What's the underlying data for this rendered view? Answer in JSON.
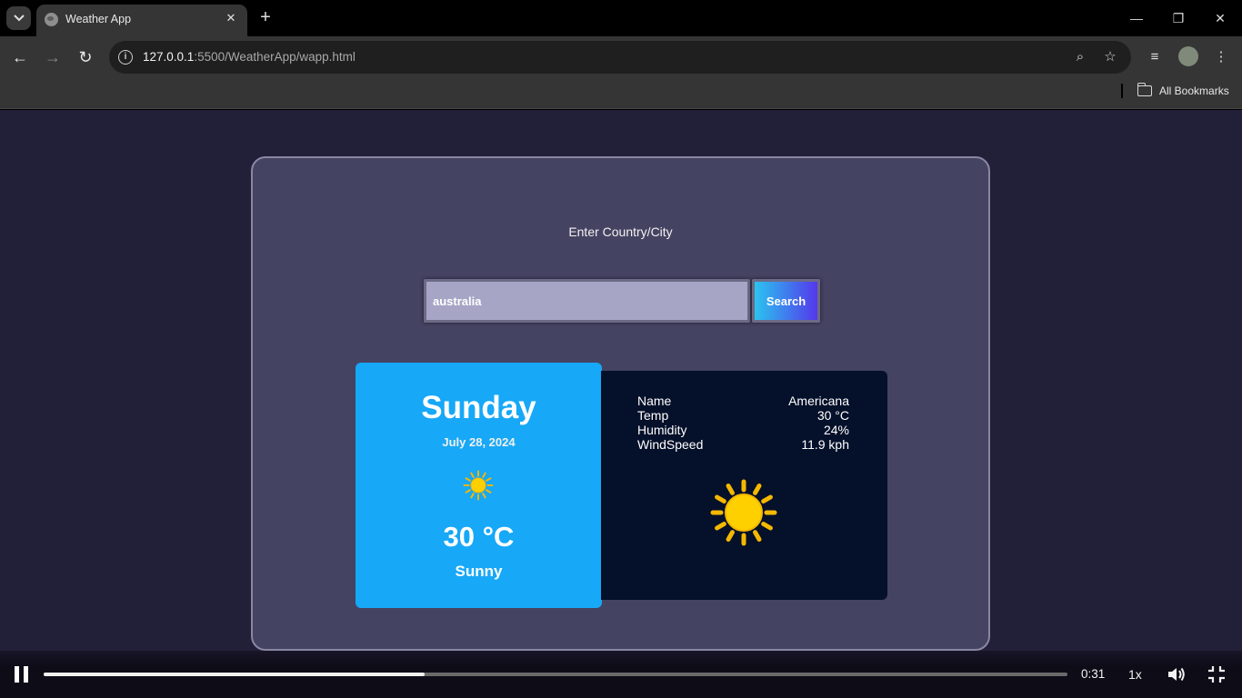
{
  "browser": {
    "tab_title": "Weather App",
    "url_host": "127.0.0.1",
    "url_path": ":5500/WeatherApp/wapp.html",
    "bookmarks_label": "All Bookmarks"
  },
  "app": {
    "prompt": "Enter Country/City",
    "search_value": "australia",
    "search_button": "Search",
    "day": "Sunday",
    "date": "July 28, 2024",
    "temperature": "30 °C",
    "condition": "Sunny",
    "details": [
      {
        "label": "Name",
        "value": "Americana"
      },
      {
        "label": "Temp",
        "value": "30 °C"
      },
      {
        "label": "Humidity",
        "value": "24%"
      },
      {
        "label": "WindSpeed",
        "value": "11.9 kph"
      }
    ]
  },
  "player": {
    "time": "0:31",
    "speed": "1x",
    "progress": 0.372
  },
  "icons": {
    "weather": "sun-icon",
    "sun_color": "#ffd000",
    "ray_color": "#f5b800"
  }
}
